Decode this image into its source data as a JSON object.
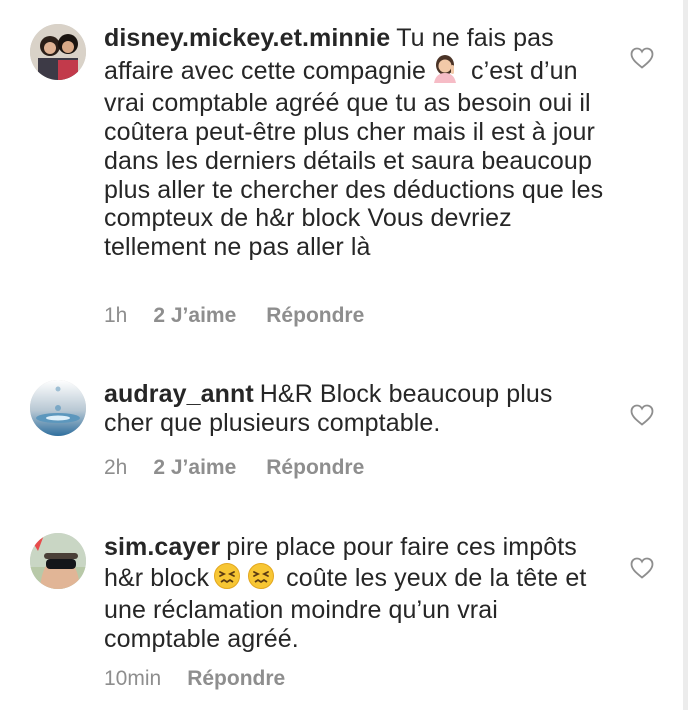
{
  "comments": [
    {
      "username": "disney.mickey.et.minnie",
      "text_part1": "Tu ne fais pas affaire avec cette compagnie",
      "text_part2": " c’est d’un vrai comptable agréé que tu as besoin oui il coûtera peut-être plus cher mais il est à jour dans les derniers détails et saura beaucoup plus aller te chercher des déductions que les compteux de h&r block Vous devriez tellement ne pas aller là",
      "emoji": "woman-shrugging-emoji",
      "time": "1h",
      "likes": "2 J’aime",
      "reply": "Répondre"
    },
    {
      "username": "audray_annt",
      "text": "H&R Block beaucoup plus cher que plusieurs comptable.",
      "time": "2h",
      "likes": "2 J’aime",
      "reply": "Répondre"
    },
    {
      "username": "sim.cayer",
      "text_part1": "pire place pour faire ces impôts h&r block",
      "text_part2": " coûte les yeux de la tête et une réclamation moindre qu’un vrai comptable agréé.",
      "emoji": "confounded-face-emoji",
      "time": "10min",
      "reply": "Répondre"
    }
  ],
  "colors": {
    "text": "#262626",
    "meta": "#8e8e8e",
    "heart_outline": "#8e8e8e"
  }
}
